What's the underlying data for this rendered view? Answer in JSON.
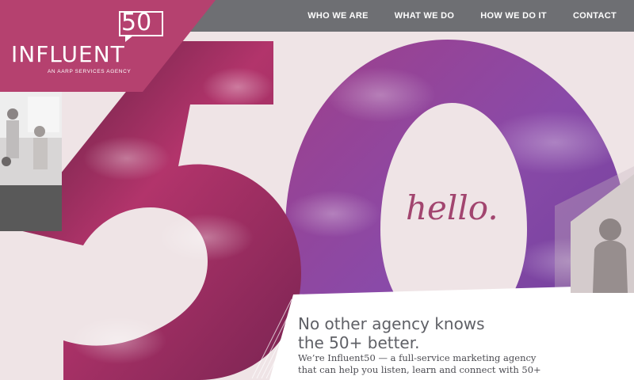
{
  "brand": {
    "name": "INFLUENT",
    "badge": "50",
    "tagline": "AN AARP SERVICES AGENCY"
  },
  "nav": {
    "items": [
      "WHO WE ARE",
      "WHAT WE DO",
      "HOW WE DO IT",
      "CONTACT"
    ]
  },
  "hero": {
    "hello": "hello.",
    "headline_line1": "No other agency knows",
    "headline_line2": "the 50+ better.",
    "body_line1": "We’re Influent50 — a full-service marketing agency",
    "body_line2": "that can help you listen, learn and connect with 50+"
  },
  "colors": {
    "brand_magenta": "#b5416f",
    "nav_gray": "#6e6f73",
    "hello_text": "#a2456f",
    "background": "#efe4e6"
  }
}
